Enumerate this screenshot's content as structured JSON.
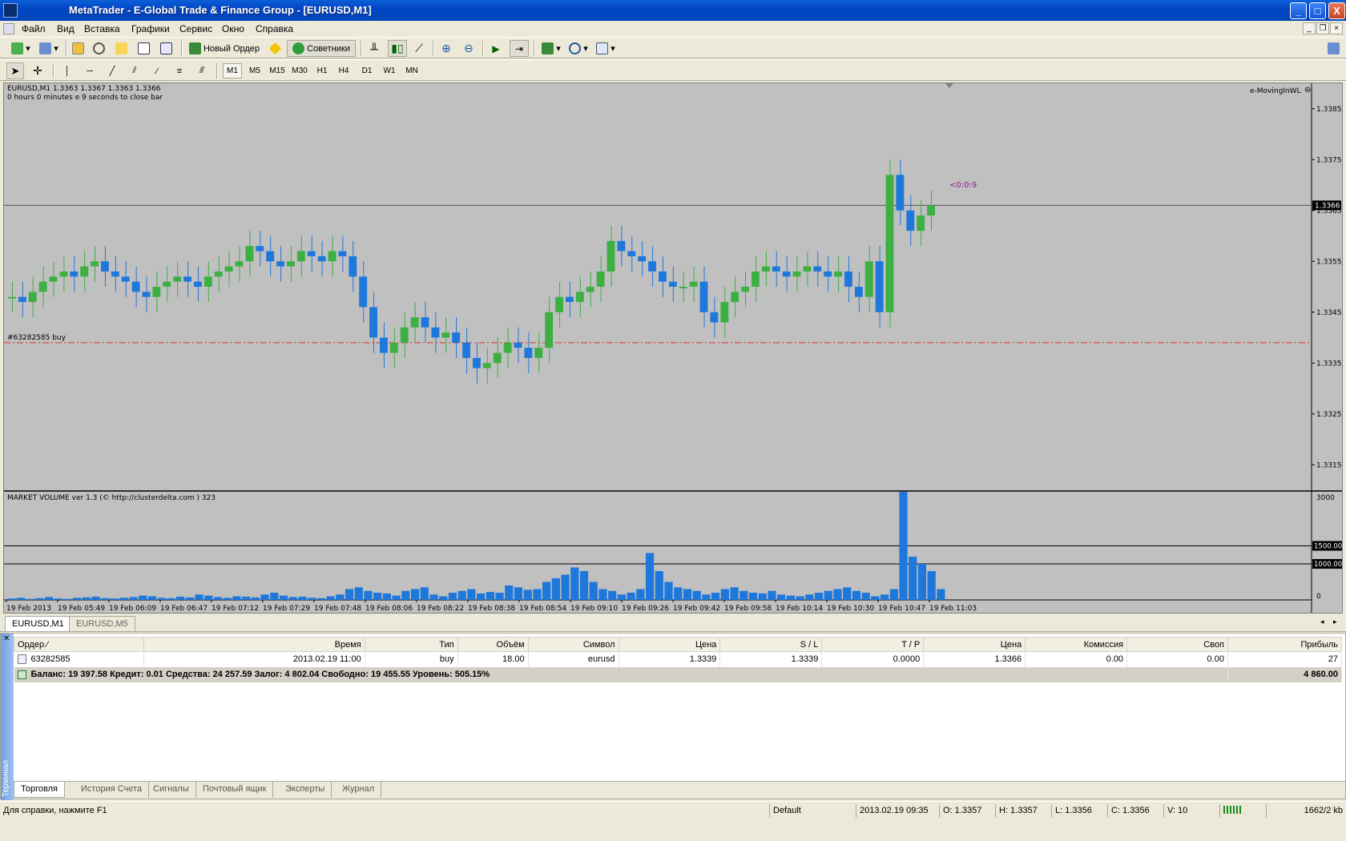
{
  "window": {
    "title": "MetaTrader - E-Global Trade & Finance Group - [EURUSD,M1]",
    "controls": {
      "minimize": "_",
      "maximize": "□",
      "close": "X"
    }
  },
  "menu": [
    "Файл",
    "Вид",
    "Вставка",
    "Графики",
    "Сервис",
    "Окно",
    "Справка"
  ],
  "toolbar": {
    "new_order_label": "Новый Ордер",
    "experts_label": "Советники"
  },
  "timeframes": [
    "M1",
    "M5",
    "M15",
    "M30",
    "H1",
    "H4",
    "D1",
    "W1",
    "MN"
  ],
  "active_timeframe": "M1",
  "chart": {
    "header_line1": "EURUSD,M1  1.3363 1.3367 1.3363 1.3366",
    "header_line2": "0 hours 0 minutes e 9 seconds to close bar",
    "indicator_name": "e-MovingInWL",
    "countdown_label": "<0:0:9",
    "order_label": "#63282585 buy",
    "current_price": "1.3366",
    "volume_indicator": "MARKET VOLUME ver 1.3 (© http://clusterdelta.com ) 323",
    "volume_levels": [
      "1500.00",
      "1000.00"
    ]
  },
  "chart_data": [
    {
      "type": "line",
      "series": [
        {
          "values": [
            1.3348,
            1.3347,
            1.3349,
            1.3351,
            1.3352,
            1.3353,
            1.3352,
            1.3354,
            1.3355,
            1.3353,
            1.3352,
            1.3351,
            1.3349,
            1.3348,
            1.335,
            1.3351,
            1.3352,
            1.3351,
            1.335,
            1.3352,
            1.3353,
            1.3354,
            1.3355,
            1.3358,
            1.3357,
            1.3355,
            1.3354,
            1.3355,
            1.3357,
            1.3356,
            1.3355,
            1.3357,
            1.3356,
            1.3352,
            1.3346,
            1.334,
            1.3337,
            1.3339,
            1.3342,
            1.3344,
            1.3342,
            1.334,
            1.3341,
            1.3339,
            1.3336,
            1.3334,
            1.3335,
            1.3337,
            1.3339,
            1.3338,
            1.3336,
            1.3338,
            1.3345,
            1.3348,
            1.3347,
            1.3349,
            1.335,
            1.3353,
            1.3359,
            1.3357,
            1.3356,
            1.3355,
            1.3353,
            1.3351,
            1.335,
            1.335,
            1.3351,
            1.3345,
            1.3343,
            1.3347,
            1.3349,
            1.335,
            1.3353,
            1.3354,
            1.3353,
            1.3352,
            1.3353,
            1.3354,
            1.3353,
            1.3352,
            1.3353,
            1.335,
            1.3348,
            1.3355,
            1.3345,
            1.3372,
            1.3365,
            1.3361,
            1.3364,
            1.3366
          ]
        }
      ],
      "y_ticks": [
        "1.3385",
        "1.3375",
        "1.3365",
        "1.3355",
        "1.3345",
        "1.3335",
        "1.3325",
        "1.3315"
      ],
      "ylim": [
        1.331,
        1.339
      ],
      "x_tick_labels": [
        "19 Feb 2013",
        "19 Feb 05:49",
        "19 Feb 06:09",
        "19 Feb 06:47",
        "19 Feb 07:12",
        "19 Feb 07:29",
        "19 Feb 07:48",
        "19 Feb 08:06",
        "19 Feb 08:22",
        "19 Feb 08:38",
        "19 Feb 08:54",
        "19 Feb 09:10",
        "19 Feb 09:26",
        "19 Feb 09:42",
        "19 Feb 09:58",
        "19 Feb 10:14",
        "19 Feb 10:30",
        "19 Feb 10:47",
        "19 Feb 11:03"
      ],
      "horizontal_lines": [
        {
          "value": 1.3366,
          "style": "solid"
        },
        {
          "value": 1.3339,
          "style": "dash-dot",
          "color": "#e03030"
        }
      ]
    },
    {
      "type": "bar",
      "y_ticks": [
        "3000",
        "1500.00",
        "1000.00",
        "0"
      ],
      "ylim": [
        0,
        3000
      ],
      "values": [
        40,
        60,
        30,
        50,
        80,
        40,
        30,
        60,
        70,
        90,
        50,
        40,
        60,
        80,
        120,
        100,
        60,
        50,
        90,
        70,
        150,
        120,
        80,
        60,
        100,
        90,
        70,
        150,
        200,
        120,
        80,
        90,
        60,
        50,
        100,
        150,
        300,
        350,
        250,
        200,
        180,
        120,
        250,
        300,
        350,
        150,
        100,
        200,
        250,
        300,
        180,
        220,
        200,
        400,
        350,
        280,
        300,
        500,
        600,
        700,
        900,
        800,
        500,
        300,
        250,
        150,
        200,
        300,
        1300,
        800,
        500,
        350,
        300,
        250,
        150,
        200,
        300,
        350,
        250,
        200,
        180,
        250,
        150,
        120,
        100,
        150,
        200,
        250,
        300,
        350,
        250,
        200,
        100,
        150,
        300,
        3000,
        1200,
        1000,
        800,
        300
      ]
    }
  ],
  "chart_tabs": [
    {
      "label": "EURUSD,M1",
      "active": true
    },
    {
      "label": "EURUSD,M5",
      "active": false
    }
  ],
  "terminal": {
    "side_label": "Терминал",
    "columns": [
      "Ордер",
      "Время",
      "Тип",
      "Объём",
      "Символ",
      "Цена",
      "S / L",
      "T / P",
      "Цена",
      "Комиссия",
      "Своп",
      "Прибыль"
    ],
    "rows": [
      {
        "order": "63282585",
        "time": "2013.02.19 11:00",
        "type": "buy",
        "volume": "18.00",
        "symbol": "eurusd",
        "price": "1.3339",
        "sl": "1.3339",
        "tp": "0.0000",
        "cur_price": "1.3366",
        "commission": "0.00",
        "swap": "0.00",
        "profit": "27"
      }
    ],
    "summary": "Баланс: 19 397.58  Кредит: 0.01  Средства: 24 257.59  Залог: 4 802.04  Свободно: 19 455.55  Уровень: 505.15%",
    "summary_profit": "4 860.00",
    "tabs": [
      "Торговля",
      "История Счета",
      "Сигналы",
      "Почтовый ящик",
      "Эксперты",
      "Журнал"
    ]
  },
  "statusbar": {
    "help": "Для справки, нажмите F1",
    "profile": "Default",
    "datetime": "2013.02.19 09:35",
    "open": "O: 1.3357",
    "high": "H: 1.3357",
    "low": "L: 1.3356",
    "close": "C: 1.3356",
    "volume": "V: 10",
    "traffic": "1662/2 kb"
  },
  "colors": {
    "chart_bg": "#c0c0c0",
    "bull": "#3cb043",
    "bear": "#1e78dc",
    "order_line": "#e03030",
    "volume_bar": "#1e78dc"
  }
}
